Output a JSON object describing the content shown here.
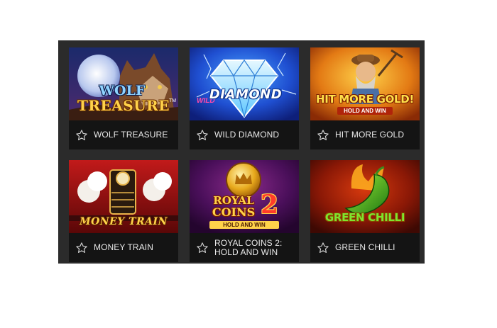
{
  "games": [
    {
      "id": "wolf-treasure",
      "title": "WOLF TREASURE",
      "art_line1": "WOLF",
      "art_line2": "TREASURE",
      "art_tm": "TM"
    },
    {
      "id": "wild-diamond",
      "title": "WILD DIAMOND",
      "art_line1": "DIAMOND",
      "art_small": "WILD"
    },
    {
      "id": "hit-more-gold",
      "title": "HIT MORE GOLD",
      "art_line1": "HIT MORE GOLD!",
      "art_sub": "HOLD AND WIN"
    },
    {
      "id": "money-train",
      "title": "MONEY TRAIN",
      "art_line1": "MONEY TRAIN"
    },
    {
      "id": "royal-coins-2",
      "title_line1": "ROYAL COINS 2:",
      "title_line2": "HOLD AND WIN",
      "art_line1": "ROYAL",
      "art_line2": "COINS",
      "art_num": "2",
      "art_sub": "HOLD AND WIN"
    },
    {
      "id": "green-chilli",
      "title": "GREEN CHILLI",
      "art_line1": "GREEN CHILLI"
    }
  ],
  "icons": {
    "favorite": "star-outline-icon"
  },
  "colors": {
    "panel_bg": "#2b2b2b",
    "card_bg": "#141414",
    "label": "#e9e9e9"
  }
}
